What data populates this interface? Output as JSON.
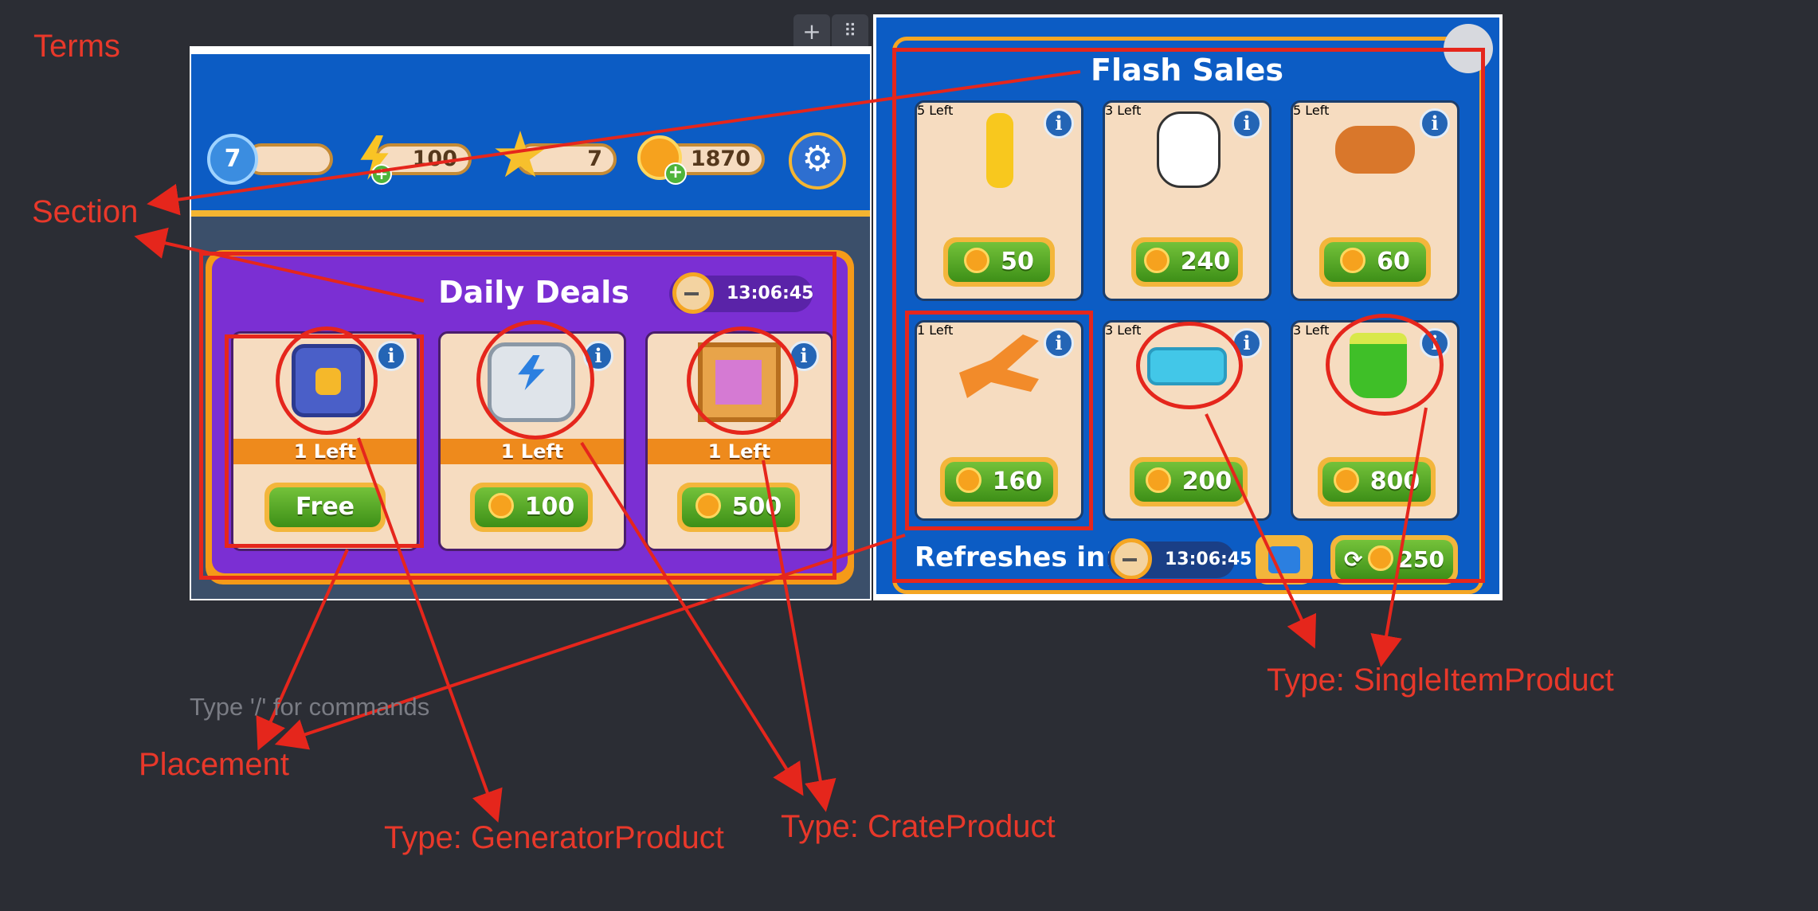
{
  "annotations": {
    "terms": "Terms",
    "section": "Section",
    "placement": "Placement",
    "type_generator": "Type: GeneratorProduct",
    "type_crate": "Type: CrateProduct",
    "type_single": "Type: SingleItemProduct"
  },
  "editor": {
    "placeholder": "Type '/' for commands",
    "add_glyph": "+",
    "drag_glyph": "⠿"
  },
  "hud": {
    "level": "7",
    "energy": "100",
    "stars": "7",
    "coins": "1870",
    "settings_icon": "gear-icon"
  },
  "daily_deals": {
    "title": "Daily Deals",
    "timer": "13:06:45",
    "items": [
      {
        "stock": "1 Left",
        "price": "Free",
        "icon": "vault-icon"
      },
      {
        "stock": "1 Left",
        "price": "100",
        "icon": "energy-generator-icon"
      },
      {
        "stock": "1 Left",
        "price": "500",
        "icon": "crate-icon"
      }
    ]
  },
  "flash_sales": {
    "title": "Flash Sales",
    "items": [
      {
        "stock": "5 Left",
        "price": "50",
        "icon": "tool-icon"
      },
      {
        "stock": "3 Left",
        "price": "240",
        "icon": "cow-icon"
      },
      {
        "stock": "5 Left",
        "price": "60",
        "icon": "log-icon"
      },
      {
        "stock": "1 Left",
        "price": "160",
        "icon": "pliers-icon"
      },
      {
        "stock": "3 Left",
        "price": "200",
        "icon": "tray-icon"
      },
      {
        "stock": "3 Left",
        "price": "800",
        "icon": "bucket-icon"
      }
    ],
    "refresh_label": "Refreshes in:",
    "refresh_timer": "13:06:45",
    "refresh_cost": "250"
  },
  "colors": {
    "annotation_red": "#e5261c",
    "panel_purple": "#7b2fd3",
    "panel_blue": "#0c5cc4",
    "stock_orange": "#ee8a1c",
    "price_green": "#4fa626"
  }
}
